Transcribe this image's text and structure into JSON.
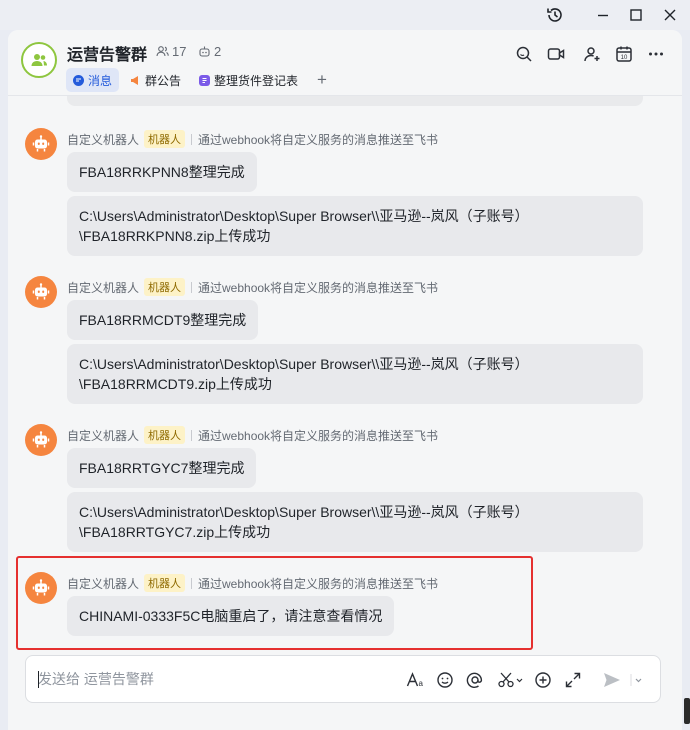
{
  "window": {
    "controls": [
      "history-icon",
      "minimize-icon",
      "maximize-icon",
      "close-icon"
    ]
  },
  "header": {
    "group_name": "运营告警群",
    "member_count": "17",
    "bot_count": "2",
    "tabs": [
      {
        "label": "消息",
        "icon": "message-icon",
        "active": true
      },
      {
        "label": "群公告",
        "icon": "megaphone-icon",
        "active": false
      },
      {
        "label": "整理货件登记表",
        "icon": "doc-icon",
        "active": false
      }
    ],
    "add_tab": "+",
    "actions": [
      "search-icon",
      "video-icon",
      "add-member-icon",
      "calendar-icon",
      "more-icon"
    ]
  },
  "messages": [
    {
      "sender": "自定义机器人",
      "tag": "机器人",
      "desc": "通过webhook将自定义服务的消息推送至飞书",
      "bubbles": [
        "FBA18RRKPNN8整理完成",
        "C:\\Users\\Administrator\\Desktop\\Super Browser\\\\亚马逊--岚风（子账号）\\FBA18RRKPNN8.zip上传成功"
      ]
    },
    {
      "sender": "自定义机器人",
      "tag": "机器人",
      "desc": "通过webhook将自定义服务的消息推送至飞书",
      "bubbles": [
        "FBA18RRMCDT9整理完成",
        "C:\\Users\\Administrator\\Desktop\\Super Browser\\\\亚马逊--岚风（子账号）\\FBA18RRMCDT9.zip上传成功"
      ]
    },
    {
      "sender": "自定义机器人",
      "tag": "机器人",
      "desc": "通过webhook将自定义服务的消息推送至飞书",
      "bubbles": [
        "FBA18RRTGYC7整理完成",
        "C:\\Users\\Administrator\\Desktop\\Super Browser\\\\亚马逊--岚风（子账号）\\FBA18RRTGYC7.zip上传成功"
      ]
    },
    {
      "sender": "自定义机器人",
      "tag": "机器人",
      "desc": "通过webhook将自定义服务的消息推送至飞书",
      "bubbles": [
        "CHINAMI-0333F5C电脑重启了，请注意查看情况"
      ]
    }
  ],
  "composer": {
    "placeholder": "发送给 运营告警群",
    "tools": [
      "font-icon",
      "emoji-icon",
      "mention-icon",
      "screenshot-icon",
      "add-icon",
      "expand-icon",
      "send-icon",
      "chevron-down-icon"
    ]
  },
  "colors": {
    "accent": "#245bdb",
    "bot_avatar": "#f5853f",
    "bot_tag_bg": "#fdf2c7",
    "highlight": "#e5302f",
    "group_ring": "#8ec63f"
  }
}
